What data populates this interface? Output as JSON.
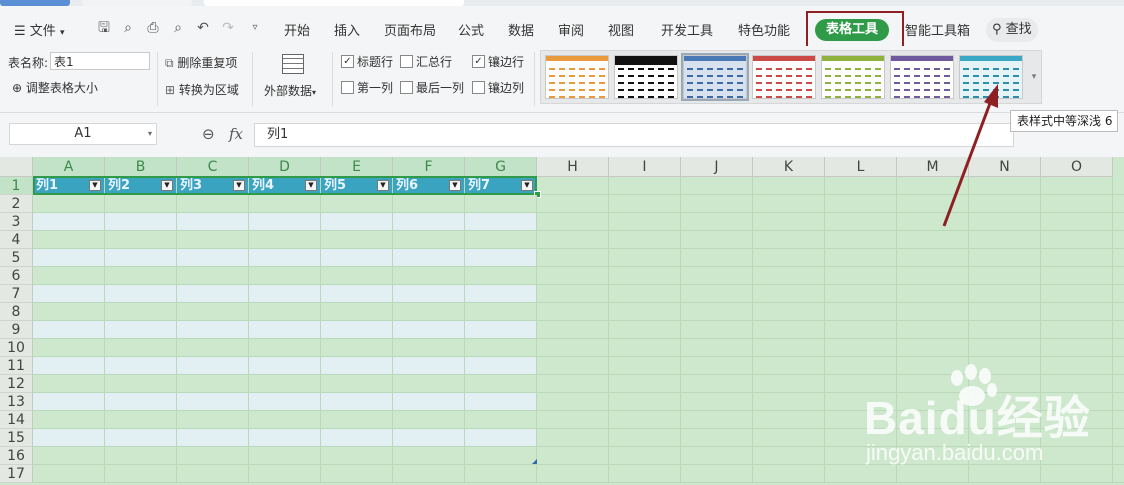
{
  "menubar": {
    "file_label": "文件",
    "tabs": [
      "开始",
      "插入",
      "页面布局",
      "公式",
      "数据",
      "审阅",
      "视图",
      "开发工具",
      "特色功能"
    ],
    "active_tab": "表格工具",
    "after_tab": "智能工具箱",
    "search_label": "查找"
  },
  "ribbon": {
    "tablename_label": "表名称:",
    "tablename_value": "表1",
    "resize_label": "调整表格大小",
    "remove_dup_label": "删除重复项",
    "convert_label": "转换为区域",
    "external_label": "外部数据",
    "options": [
      {
        "label": "标题行",
        "checked": true
      },
      {
        "label": "汇总行",
        "checked": false
      },
      {
        "label": "镶边行",
        "checked": true
      },
      {
        "label": "第一列",
        "checked": false
      },
      {
        "label": "最后一列",
        "checked": false
      },
      {
        "label": "镶边列",
        "checked": false
      }
    ],
    "styles": [
      {
        "head": "#e99a3c",
        "line": "#e99a3c",
        "bg": "#fff"
      },
      {
        "head": "#111111",
        "line": "#111111",
        "bg": "#fff"
      },
      {
        "head": "#4a78b6",
        "line": "#3c6aa8",
        "bg": "#d8e2ee"
      },
      {
        "head": "#cc4a46",
        "line": "#cc4a46",
        "bg": "#fff"
      },
      {
        "head": "#8fb23c",
        "line": "#8fb23c",
        "bg": "#fff"
      },
      {
        "head": "#6e5a9c",
        "line": "#6e5a9c",
        "bg": "#fff"
      },
      {
        "head": "#3aa8c4",
        "line": "#2c8eaa",
        "bg": "#e6f3f7"
      }
    ]
  },
  "formulabar": {
    "cell_ref": "A1",
    "fx_label": "fx",
    "value": "列1"
  },
  "tooltip": "表样式中等深浅 6",
  "grid": {
    "columns": [
      "A",
      "B",
      "C",
      "D",
      "E",
      "F",
      "G",
      "H",
      "I",
      "J",
      "K",
      "L",
      "M",
      "N",
      "O"
    ],
    "rows": [
      "1",
      "2",
      "3",
      "4",
      "5",
      "6",
      "7",
      "8",
      "9",
      "10",
      "11",
      "12",
      "13",
      "14",
      "15",
      "16",
      "17"
    ],
    "table_headers": [
      "列1",
      "列2",
      "列3",
      "列4",
      "列5",
      "列6",
      "列7"
    ]
  },
  "colors": {
    "accent": "#2f9a48",
    "highlight_box": "#8e1f22",
    "table_header": "#3aa3bf",
    "band_light": "#e2f0f4",
    "band_green": "#cde8cc"
  },
  "watermark": {
    "brand": "Baidu经验",
    "url": "jingyan.baidu.com"
  }
}
